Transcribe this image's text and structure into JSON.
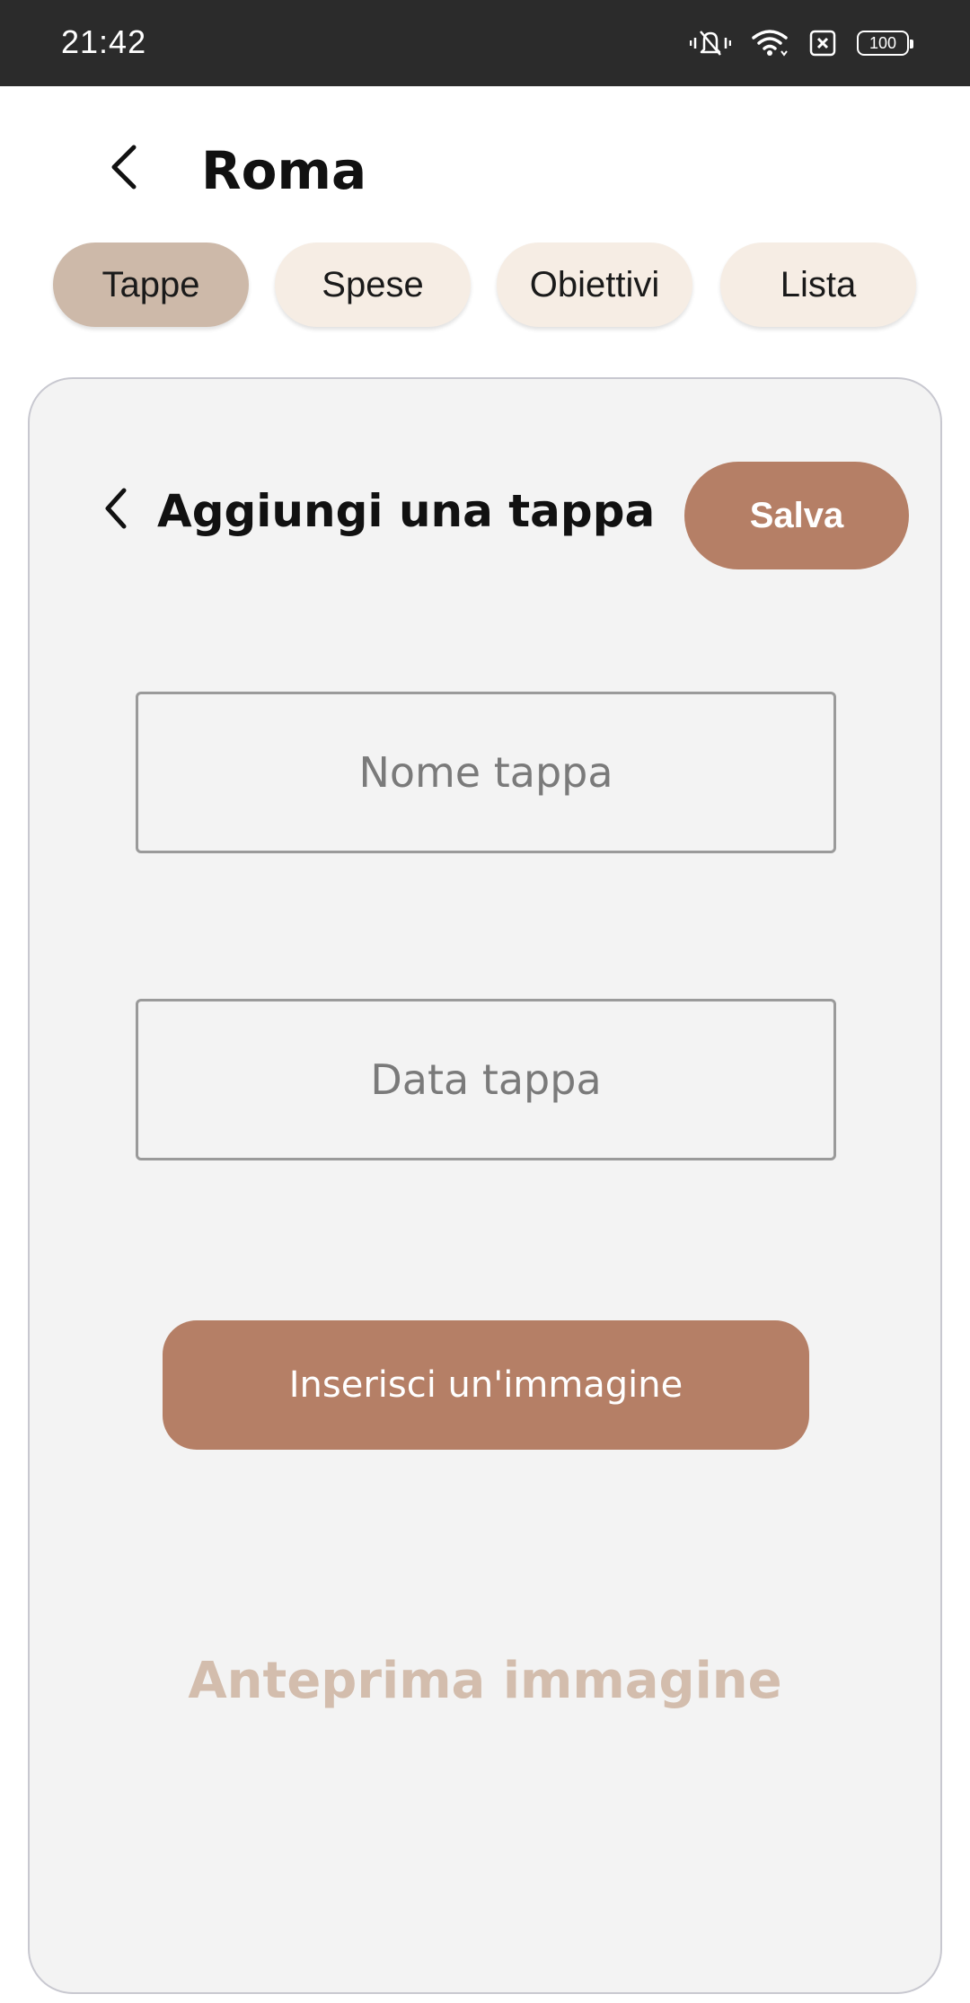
{
  "status_bar": {
    "time": "21:42",
    "battery": "100",
    "icons": [
      "vibrate-mute-icon",
      "wifi-icon",
      "sim-off-icon",
      "battery-icon"
    ]
  },
  "header": {
    "title": "Roma",
    "back_icon": "chevron-left-icon"
  },
  "tabs": [
    {
      "label": "Tappe",
      "active": true
    },
    {
      "label": "Spese",
      "active": false
    },
    {
      "label": "Obiettivi",
      "active": false
    },
    {
      "label": "Lista",
      "active": false
    }
  ],
  "form": {
    "title": "Aggiungi una tappa",
    "back_icon": "chevron-left-icon",
    "save_label": "Salva",
    "name_field": {
      "value": "",
      "placeholder": "Nome tappa"
    },
    "date_field": {
      "value": "",
      "placeholder": "Data tappa"
    },
    "image_button_label": "Inserisci un'immagine",
    "preview_label": "Anteprima immagine"
  },
  "colors": {
    "accent": "#b57f66",
    "tab_active": "#cdb9a9",
    "tab_inactive": "#f6ede4",
    "card_background": "#f3f3f3",
    "preview_text": "#d3bdad",
    "status_bar": "#2b2b2b"
  }
}
